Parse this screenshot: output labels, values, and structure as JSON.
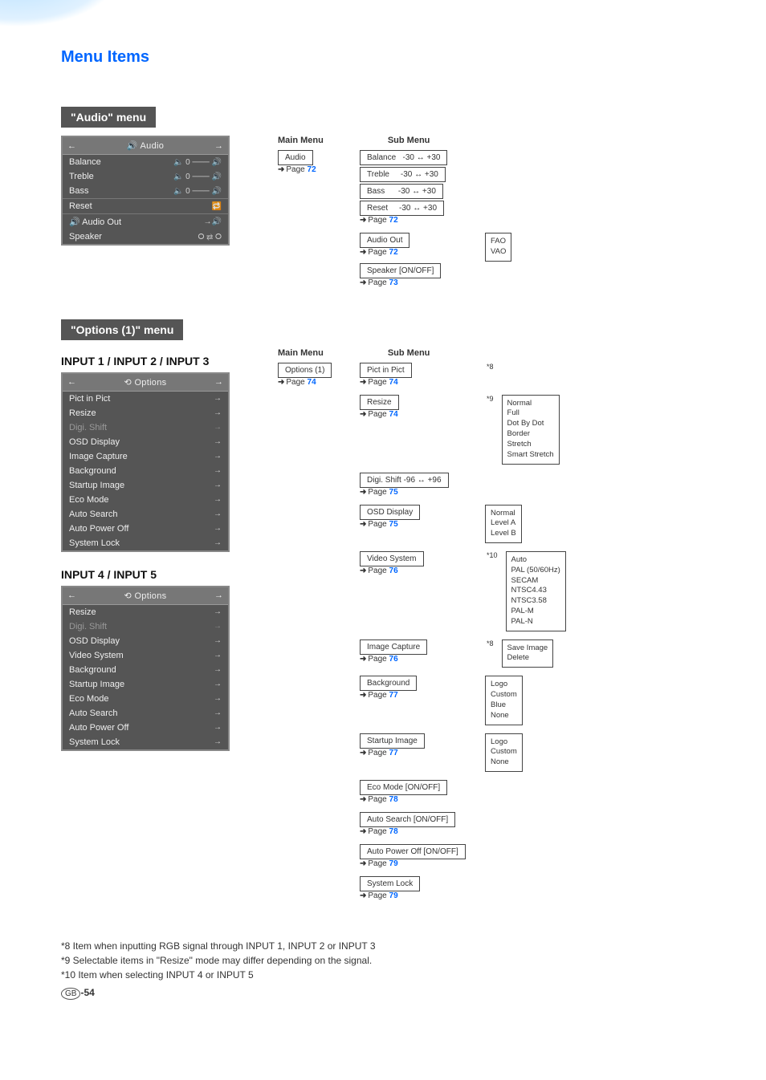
{
  "page_title": "Menu Items",
  "audio": {
    "header": "\"Audio\" menu",
    "osd_title": "Audio",
    "items": [
      {
        "label": "Balance",
        "val": "0"
      },
      {
        "label": "Treble",
        "val": "0"
      },
      {
        "label": "Bass",
        "val": "0"
      },
      {
        "label": "Reset",
        "val": ""
      },
      {
        "label": "Audio Out",
        "val": ""
      },
      {
        "label": "Speaker",
        "val": ""
      }
    ],
    "diagram": {
      "main_label": "Main Menu",
      "sub_label": "Sub Menu",
      "main_box": "Audio",
      "main_page": "72",
      "subs": [
        {
          "label": "Balance",
          "range": "-30 ↔ +30"
        },
        {
          "label": "Treble",
          "range": "-30 ↔ +30"
        },
        {
          "label": "Bass",
          "range": "-30 ↔ +30"
        },
        {
          "label": "Reset",
          "range": "-30 ↔ +30"
        }
      ],
      "sub_page1": "72",
      "audio_out": {
        "label": "Audio Out",
        "page": "72",
        "leaves": [
          "FAO",
          "VAO"
        ]
      },
      "speaker": {
        "label": "Speaker [ON/OFF]",
        "page": "73"
      }
    }
  },
  "options": {
    "header": "\"Options (1)\" menu",
    "heading_a": "INPUT 1 / INPUT 2 / INPUT 3",
    "heading_b": "INPUT 4 / INPUT 5",
    "osd_title": "Options",
    "items_a": [
      {
        "label": "Pict in Pict"
      },
      {
        "label": "Resize"
      },
      {
        "label": "Digi. Shift",
        "faded": true
      },
      {
        "label": "OSD Display"
      },
      {
        "label": "Image Capture"
      },
      {
        "label": "Background"
      },
      {
        "label": "Startup Image"
      },
      {
        "label": "Eco Mode"
      },
      {
        "label": "Auto Search"
      },
      {
        "label": "Auto Power Off"
      },
      {
        "label": "System Lock"
      }
    ],
    "items_b": [
      {
        "label": "Resize"
      },
      {
        "label": "Digi. Shift",
        "faded": true
      },
      {
        "label": "OSD Display"
      },
      {
        "label": "Video System"
      },
      {
        "label": "Background"
      },
      {
        "label": "Startup Image"
      },
      {
        "label": "Eco Mode"
      },
      {
        "label": "Auto Search"
      },
      {
        "label": "Auto Power Off"
      },
      {
        "label": "System Lock"
      }
    ],
    "diagram": {
      "main_label": "Main Menu",
      "sub_label": "Sub Menu",
      "main_box": "Options (1)",
      "main_page": "74",
      "subs": [
        {
          "label": "Pict in Pict",
          "page": "74",
          "mark": "*8"
        },
        {
          "label": "Resize",
          "page": "74",
          "mark": "*9",
          "leaves": [
            "Normal",
            "Full",
            "Dot By Dot",
            "Border",
            "Stretch",
            "Smart Stretch"
          ]
        },
        {
          "label": "Digi. Shift    -96 ↔ +96",
          "page": "75"
        },
        {
          "label": "OSD Display",
          "page": "75",
          "leaves": [
            "Normal",
            "Level A",
            "Level B"
          ]
        },
        {
          "label": "Video System",
          "page": "76",
          "mark": "*10",
          "leaves": [
            "Auto",
            "PAL (50/60Hz)",
            "SECAM",
            "NTSC4.43",
            "NTSC3.58",
            "PAL-M",
            "PAL-N"
          ]
        },
        {
          "label": "Image Capture",
          "page": "76",
          "mark": "*8",
          "leaves": [
            "Save Image",
            "Delete"
          ]
        },
        {
          "label": "Background",
          "page": "77",
          "leaves": [
            "Logo",
            "Custom",
            "Blue",
            "None"
          ]
        },
        {
          "label": "Startup Image",
          "page": "77",
          "leaves": [
            "Logo",
            "Custom",
            "None"
          ]
        },
        {
          "label": "Eco Mode [ON/OFF]",
          "page": "78"
        },
        {
          "label": "Auto Search [ON/OFF]",
          "page": "78"
        },
        {
          "label": "Auto Power Off [ON/OFF]",
          "page": "79"
        },
        {
          "label": "System Lock",
          "page": "79"
        }
      ]
    }
  },
  "footnotes": [
    "*8  Item when inputting RGB signal through INPUT 1, INPUT 2 or INPUT 3",
    "*9  Selectable items in \"Resize\" mode may differ depending on the signal.",
    "*10 Item when selecting INPUT 4 or INPUT 5"
  ],
  "page_num_prefix": "GB",
  "page_num": "-54",
  "page_word": "Page"
}
